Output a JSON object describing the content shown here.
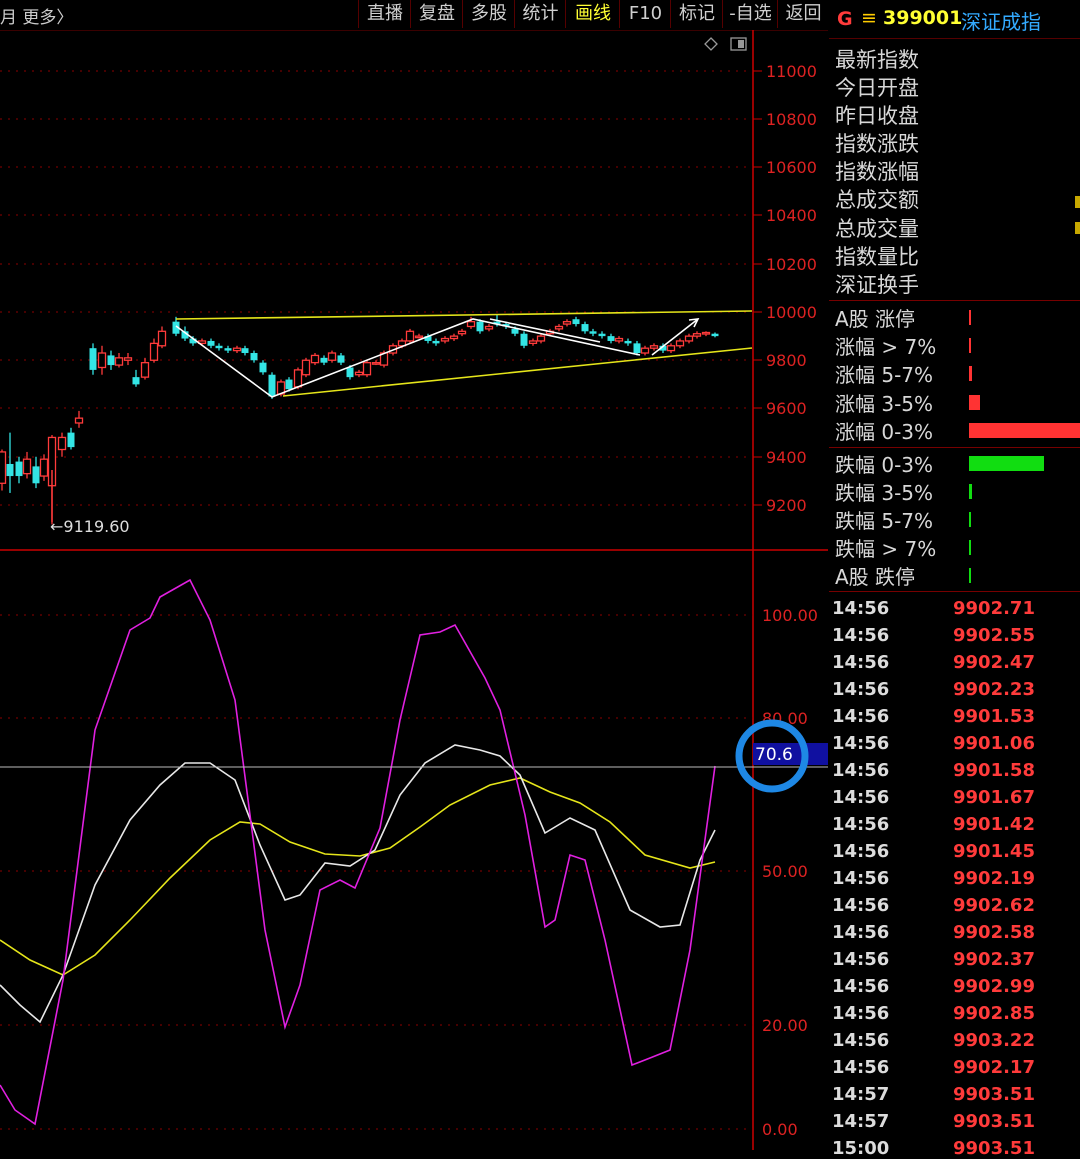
{
  "toolbar": {
    "left_text": "月 更多〉",
    "buttons": [
      "直播",
      "复盘",
      "多股",
      "统计",
      "画线",
      "F10",
      "标记",
      "-自选",
      "返回"
    ],
    "active_button": "画线"
  },
  "chart": {
    "price_axis_labels": [
      "11000",
      "10800",
      "10600",
      "10400",
      "10200",
      "10000",
      "9800",
      "9600",
      "9400",
      "9200"
    ],
    "indicator_axis_labels": [
      "100.00",
      "80.00",
      "50.00",
      "20.00",
      "0.00"
    ],
    "low_marker": "←9119.60",
    "current_value_label": "70.6",
    "colors": {
      "up": "#ff3b3b",
      "down": "#33e5e5",
      "line_white": "#e8e8e8",
      "line_yellow": "#e5e51a",
      "line_magenta": "#e020e0",
      "axis": "#cc0000",
      "highlight": "#1e88e5"
    }
  },
  "stock": {
    "market_icon": "G",
    "separator": "≡",
    "code": "399001",
    "name": "深证成指"
  },
  "info_labels": [
    "最新指数",
    "今日开盘",
    "昨日收盘",
    "指数涨跌",
    "指数涨幅",
    "总成交额",
    "总成交量",
    "指数量比",
    "深证换手"
  ],
  "distribution": [
    {
      "label": "A股 涨停",
      "ratio": 0.02,
      "color": "#ff3333"
    },
    {
      "label": "涨幅 > 7%",
      "ratio": 0.02,
      "color": "#ff3333"
    },
    {
      "label": "涨幅 5-7%",
      "ratio": 0.03,
      "color": "#ff3333"
    },
    {
      "label": "涨幅 3-5%",
      "ratio": 0.1,
      "color": "#ff3333"
    },
    {
      "label": "涨幅 0-3%",
      "ratio": 1.0,
      "color": "#ff3333"
    },
    {
      "label": "跌幅 0-3%",
      "ratio": 0.68,
      "color": "#11dd11"
    },
    {
      "label": "跌幅 3-5%",
      "ratio": 0.03,
      "color": "#11dd11"
    },
    {
      "label": "跌幅 5-7%",
      "ratio": 0.015,
      "color": "#11dd11"
    },
    {
      "label": "跌幅 > 7%",
      "ratio": 0.005,
      "color": "#11dd11"
    },
    {
      "label": "A股 跌停",
      "ratio": 0.005,
      "color": "#11dd11"
    }
  ],
  "ticks": [
    {
      "time": "14:56",
      "price": "9902.71"
    },
    {
      "time": "14:56",
      "price": "9902.55"
    },
    {
      "time": "14:56",
      "price": "9902.47"
    },
    {
      "time": "14:56",
      "price": "9902.23"
    },
    {
      "time": "14:56",
      "price": "9901.53"
    },
    {
      "time": "14:56",
      "price": "9901.06"
    },
    {
      "time": "14:56",
      "price": "9901.58"
    },
    {
      "time": "14:56",
      "price": "9901.67"
    },
    {
      "time": "14:56",
      "price": "9901.42"
    },
    {
      "time": "14:56",
      "price": "9901.45"
    },
    {
      "time": "14:56",
      "price": "9902.19"
    },
    {
      "time": "14:56",
      "price": "9902.62"
    },
    {
      "time": "14:56",
      "price": "9902.58"
    },
    {
      "time": "14:56",
      "price": "9902.37"
    },
    {
      "time": "14:56",
      "price": "9902.99"
    },
    {
      "time": "14:56",
      "price": "9902.85"
    },
    {
      "time": "14:56",
      "price": "9903.22"
    },
    {
      "time": "14:56",
      "price": "9902.17"
    },
    {
      "time": "14:57",
      "price": "9903.51"
    },
    {
      "time": "14:57",
      "price": "9903.51"
    },
    {
      "time": "15:00",
      "price": "9903.51"
    }
  ]
}
